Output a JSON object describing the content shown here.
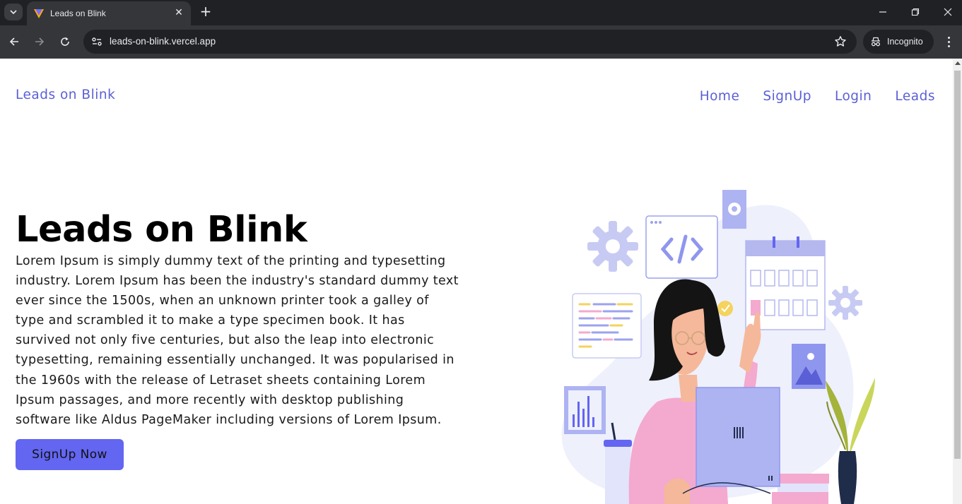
{
  "browser": {
    "tab_title": "Leads on Blink",
    "url": "leads-on-blink.vercel.app",
    "incognito_label": "Incognito"
  },
  "nav": {
    "brand": "Leads on Blink",
    "links": [
      "Home",
      "SignUp",
      "Login",
      "Leads"
    ]
  },
  "hero": {
    "title": "Leads on Blink",
    "text": "Lorem Ipsum is simply dummy text of the printing and typesetting industry. Lorem Ipsum has been the industry's standard dummy text ever since the 1500s, when an unknown printer took a galley of type and scrambled it to make a type specimen book. It has survived not only five centuries, but also the leap into electronic typesetting, remaining essentially unchanged. It was popularised in the 1960s with the release of Letraset sheets containing Lorem Ipsum passages, and more recently with desktop publishing software like Aldus PageMaker including versions of Lorem Ipsum.",
    "cta": "SignUp Now"
  },
  "colors": {
    "accent": "#6366f1",
    "nav_link": "#5b5fd6"
  }
}
